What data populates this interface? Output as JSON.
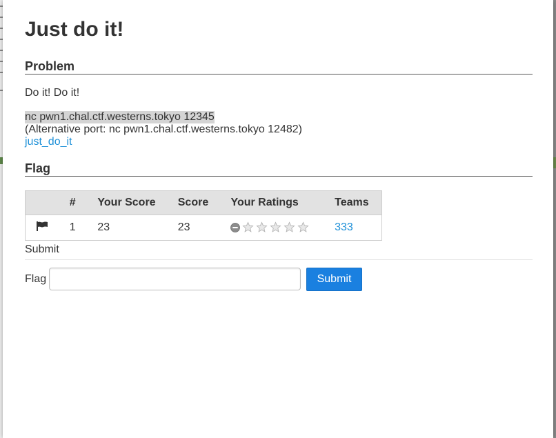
{
  "challenge": {
    "title": "Just do it!"
  },
  "problem": {
    "heading": "Problem",
    "description": "Do it! Do it!",
    "command": "nc pwn1.chal.ctf.westerns.tokyo 12345",
    "alternative": "(Alternative port: nc pwn1.chal.ctf.westerns.tokyo 12482)",
    "file_link": "just_do_it"
  },
  "flag": {
    "heading": "Flag",
    "table": {
      "headers": [
        "",
        "#",
        "Your Score",
        "Score",
        "Your Ratings",
        "Teams"
      ],
      "rows": [
        {
          "icon": "flag-icon",
          "number": "1",
          "your_score": "23",
          "score": "23",
          "ratings_stars": 5,
          "rating_value": 0,
          "teams": "333"
        }
      ]
    },
    "submit_label": "Submit",
    "flag_field_label": "Flag",
    "flag_input_value": "",
    "flag_input_placeholder": "",
    "submit_button": "Submit"
  },
  "colors": {
    "link": "#1e90d8",
    "button": "#1a80e0",
    "table_header": "#e2e2e2",
    "highlight": "#d4d4d4"
  }
}
